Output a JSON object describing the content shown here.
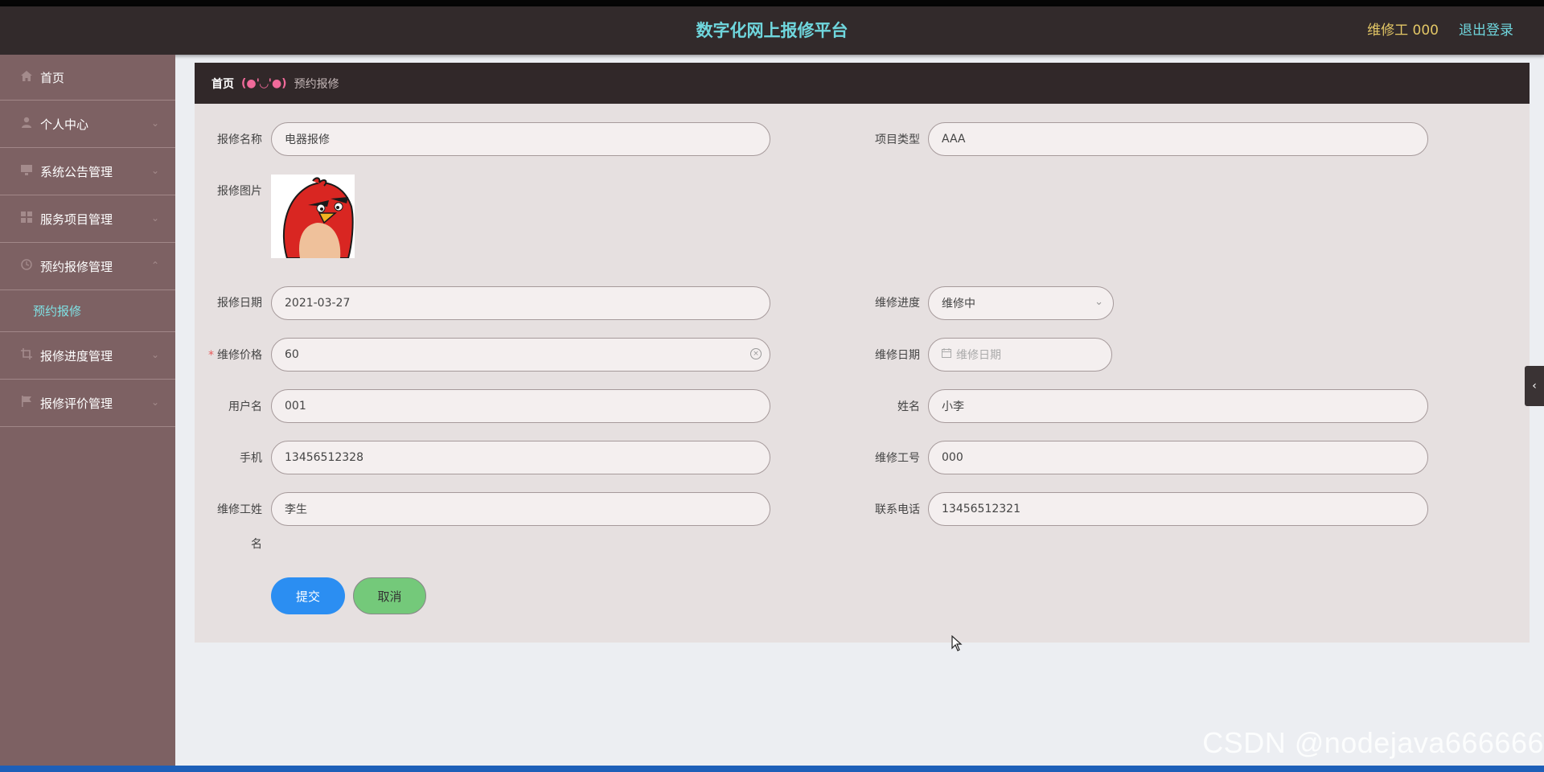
{
  "header": {
    "title": "数字化网上报修平台",
    "user": "维修工 000",
    "logout": "退出登录"
  },
  "sidebar": {
    "items": [
      {
        "label": "首页",
        "icon": "home-icon"
      },
      {
        "label": "个人中心",
        "icon": "user-icon"
      },
      {
        "label": "系统公告管理",
        "icon": "monitor-icon"
      },
      {
        "label": "服务项目管理",
        "icon": "grid-icon"
      },
      {
        "label": "预约报修管理",
        "icon": "clock-icon"
      },
      {
        "label": "预约报修",
        "icon": ""
      },
      {
        "label": "报修进度管理",
        "icon": "crop-icon"
      },
      {
        "label": "报修评价管理",
        "icon": "flag-icon"
      }
    ]
  },
  "breadcrumb": {
    "home": "首页",
    "separator": "(●'◡'●)",
    "current": "预约报修"
  },
  "form": {
    "name_label": "报修名称",
    "name_value": "电器报修",
    "type_label": "项目类型",
    "type_value": "AAA",
    "image_label": "报修图片",
    "date_label": "报修日期",
    "date_value": "2021-03-27",
    "progress_label": "维修进度",
    "progress_value": "维修中",
    "price_required": "*",
    "price_label": "维修价格",
    "price_value": "60",
    "repair_date_label": "维修日期",
    "repair_date_placeholder": "维修日期",
    "username_label": "用户名",
    "username_value": "001",
    "realname_label": "姓名",
    "realname_value": "小李",
    "phone_label": "手机",
    "phone_value": "13456512328",
    "worker_no_label": "维修工号",
    "worker_no_value": "000",
    "worker_name_label_1": "维修工姓",
    "worker_name_label_2": "名",
    "worker_name_value": "李生",
    "contact_label": "联系电话",
    "contact_value": "13456512321"
  },
  "buttons": {
    "submit": "提交",
    "cancel": "取消"
  },
  "watermark": "CSDN @nodejava666666",
  "colors": {
    "header_bg": "#322a2b",
    "title": "#6fd6dd",
    "user": "#e3c766",
    "sidebar_bg": "#7d6163",
    "submit": "#2b8ef2",
    "cancel": "#74c97a"
  }
}
